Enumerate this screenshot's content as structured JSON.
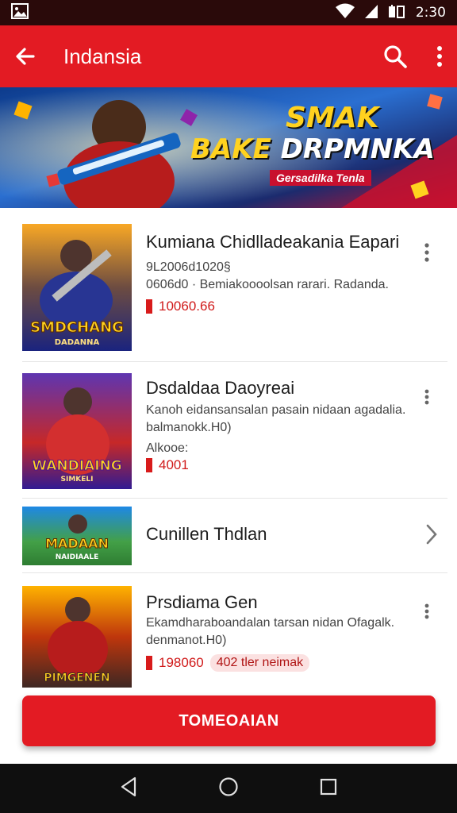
{
  "status_bar": {
    "time": "2:30",
    "icons": [
      "image-icon",
      "wifi-icon",
      "signal-icon",
      "battery-icon"
    ]
  },
  "app_bar": {
    "title": "Indansia",
    "icons": [
      "back-arrow-icon",
      "search-icon",
      "more-vert-icon"
    ]
  },
  "banner": {
    "title_line1": "SMAK",
    "title_line2_a": "BAKE ",
    "title_line2_b": "DRPMNKA",
    "subtitle": "Gersadilka Tenla"
  },
  "items": [
    {
      "title": "Kumiana Chidlladeakania Eapari",
      "meta1": "9L2006d1020§",
      "meta2": "0606d0 · Bemiakoooolsan rarari. Radanda.",
      "price": "10060.66",
      "thumb_text": "SMDCHANG",
      "thumb_sub": "DADANNA"
    },
    {
      "title": "Dsdaldaa Daoyreai",
      "meta1": "Kanoh eidansansalan pasain nidaan agadalia. balmanokk.H0)",
      "meta2": "Alkooe:",
      "price": "4001",
      "thumb_text": "WANDIAING",
      "thumb_sub": "SIMKELI"
    },
    {
      "title": "Cunillen Thdlan",
      "thumb_text": "MADAAN",
      "thumb_sub": "NAIDIAALE"
    },
    {
      "title": "Prsdiama Gen",
      "meta1": "Ekamdharaboandalan tarsan nidan Ofagalk. denmanot.H0)",
      "price": "198060",
      "tag": "402 tler neimak",
      "thumb_text": "PIMGENEN"
    }
  ],
  "cta": {
    "label": "TOMEOAIAN"
  },
  "nav": {
    "icons": [
      "back-nav-icon",
      "home-nav-icon",
      "recents-nav-icon"
    ]
  },
  "colors": {
    "primary": "#e31b23",
    "status_bar": "#2a0a0a",
    "nav_bar": "#0f0f0f",
    "price": "#d01a1a"
  }
}
